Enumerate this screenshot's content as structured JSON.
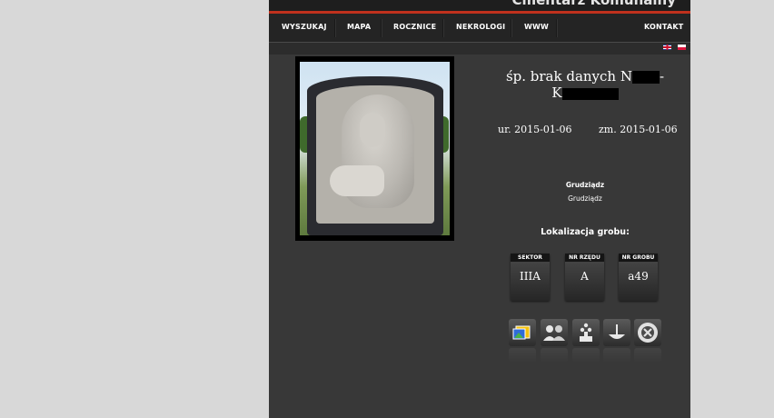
{
  "header": {
    "site_title": "Cmentarz Komunalny"
  },
  "nav": {
    "items": [
      {
        "label": "WYSZUKAJ"
      },
      {
        "label": "MAPA"
      },
      {
        "label": "ROCZNICE"
      },
      {
        "label": "NEKROLOGI"
      },
      {
        "label": "WWW"
      },
      {
        "label": "KONTAKT"
      }
    ]
  },
  "languages": [
    {
      "icon": "flag-en-icon"
    },
    {
      "icon": "flag-pl-icon"
    }
  ],
  "person": {
    "name_prefix": "śp. brak danych N",
    "name_dash": "-",
    "name_line2_prefix": "K",
    "born": "ur. 2015-01-06",
    "died": "zm. 2015-01-06",
    "place_bold": "Grudziądz",
    "place": "Grudziądz"
  },
  "grave": {
    "heading": "Lokalizacja grobu:",
    "boxes": [
      {
        "label": "SEKTOR",
        "value": "IIIA"
      },
      {
        "label": "NR RZĘDU",
        "value": "A"
      },
      {
        "label": "NR GROBU",
        "value": "a49"
      }
    ]
  },
  "actions": [
    {
      "icon": "gallery-icon"
    },
    {
      "icon": "family-icon"
    },
    {
      "icon": "memorial-icon"
    },
    {
      "icon": "candle-icon"
    },
    {
      "icon": "close-circle-icon"
    }
  ],
  "colors": {
    "accent": "#c0311d",
    "page_bg": "#383838",
    "outer_bg": "#d8d8d8"
  }
}
